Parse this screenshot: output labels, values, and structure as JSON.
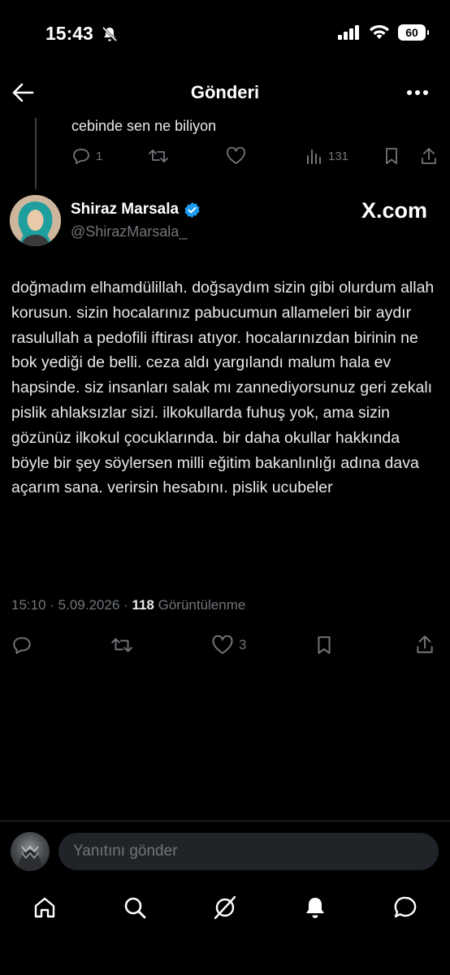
{
  "status_bar": {
    "time": "15:43",
    "battery": "60"
  },
  "header": {
    "title": "Gönderi"
  },
  "previous_post": {
    "text": "cebinde sen ne biliyon",
    "reply_count": "1",
    "view_count": "131"
  },
  "post": {
    "author_name": "Shiraz Marsala",
    "author_handle": "@ShirazMarsala_",
    "watermark": "X.com",
    "body": "doğmadım elhamdülillah. doğsaydım sizin gibi olurdum allah korusun. sizin hocalarınız pabucumun allameleri bir aydır rasulullah a pedofili iftirası atıyor. hocalarınızdan birinin ne bok yediği de belli. ceza aldı yargılandı malum hala ev hapsinde. siz insanları salak mı zannediyorsunuz geri zekalı pislik ahlaksızlar sizi. ilkokullarda fuhuş yok, ama sizin gözünüz ilkokul çocuklarında. bir daha okullar hakkında böyle bir şey söylersen milli eğitim bakanlınlığı adına dava açarım sana. verirsin hesabını. pislik ucubeler",
    "time": "15:10",
    "date": "5.09.2026",
    "views": "118",
    "views_label": "Görüntülenme",
    "like_count": "3"
  },
  "reply_bar": {
    "placeholder": "Yanıtını gönder"
  },
  "colors": {
    "background": "#000000",
    "text": "#e7e9ea",
    "muted": "#71767b",
    "verified": "#1d9bf0"
  }
}
